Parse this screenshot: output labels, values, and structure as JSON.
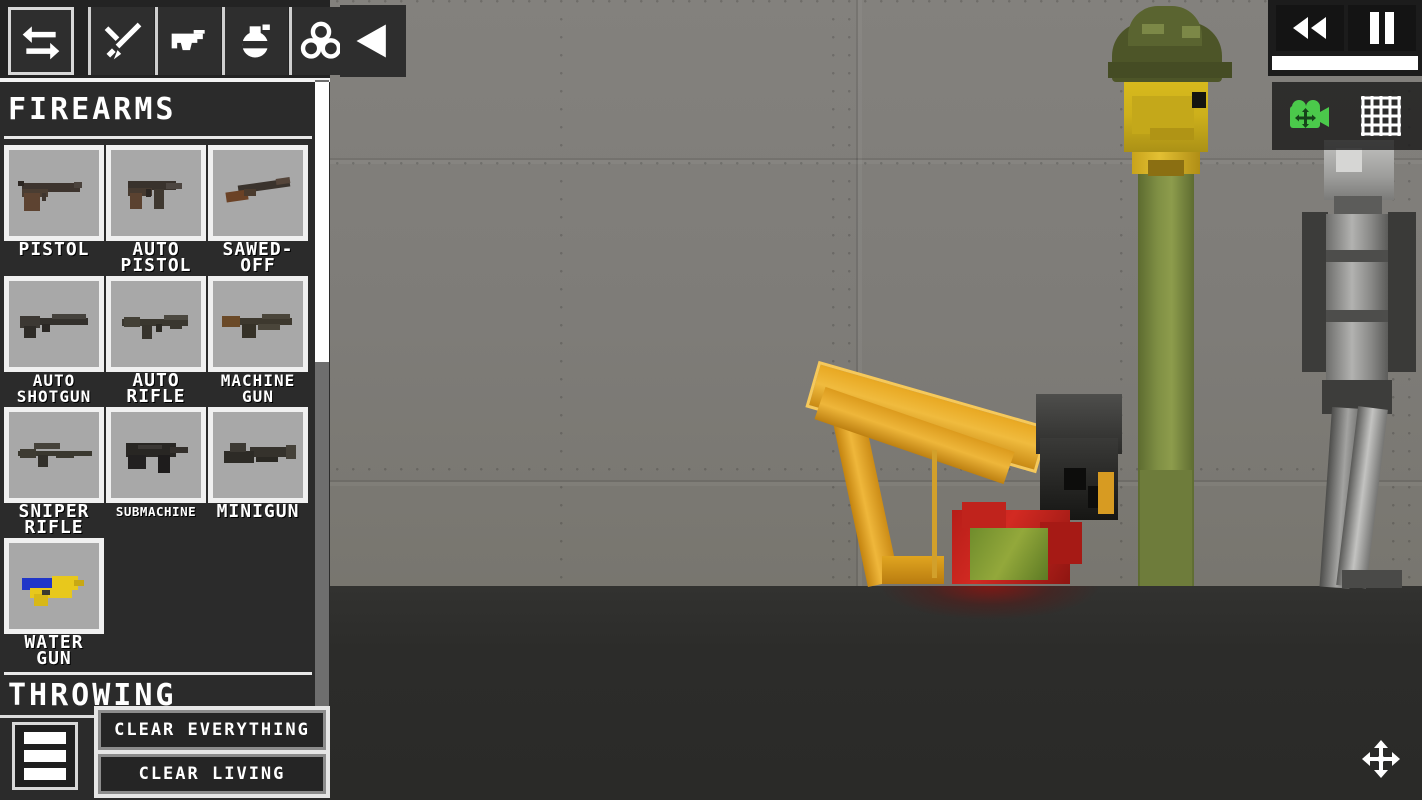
{
  "toolbar": {
    "items": [
      {
        "name": "swap-icon",
        "label": "Swap"
      },
      {
        "name": "melee-icon",
        "label": "Melee"
      },
      {
        "name": "firearms-icon",
        "label": "Firearms"
      },
      {
        "name": "throwing-icon",
        "label": "Throwing"
      },
      {
        "name": "biohazard-icon",
        "label": "Biohazard"
      }
    ]
  },
  "back_button": {
    "label": "Back",
    "icon": "left-triangle-icon"
  },
  "sidebar": {
    "sections": [
      {
        "title": "FIREARMS"
      },
      {
        "title": "THROWING"
      }
    ],
    "weapons": [
      {
        "label": "PISTOL",
        "icon": "pistol-icon",
        "size": "s18"
      },
      {
        "label": "AUTO\nPISTOL",
        "icon": "auto-pistol-icon",
        "size": "s18"
      },
      {
        "label": "SAWED-\nOFF",
        "icon": "sawed-off-icon",
        "size": "s18"
      },
      {
        "label": "AUTO\nSHOTGUN",
        "icon": "auto-shotgun-icon",
        "size": "s16"
      },
      {
        "label": "AUTO\nRIFLE",
        "icon": "auto-rifle-icon",
        "size": "s18"
      },
      {
        "label": "MACHINE\nGUN",
        "icon": "machine-gun-icon",
        "size": "s16"
      },
      {
        "label": "SNIPER\nRIFLE",
        "icon": "sniper-rifle-icon",
        "size": "s18"
      },
      {
        "label": "SUBMACHINE",
        "icon": "submachine-icon",
        "size": "s13"
      },
      {
        "label": "MINIGUN",
        "icon": "minigun-icon",
        "size": "s18"
      },
      {
        "label": "WATER\nGUN",
        "icon": "water-gun-icon",
        "size": "s18"
      }
    ],
    "menu_button": {
      "name": "menu-icon",
      "label": "Menu"
    },
    "clear_everything": "CLEAR EVERYTHING",
    "clear_living": "CLEAR LIVING"
  },
  "top_right": {
    "rewind_label": "Rewind",
    "pause_label": "Pause",
    "progress_percent": 100,
    "camera_label": "Camera Move",
    "grid_label": "Grid"
  },
  "bottom_right": {
    "move_cursor_label": "Move"
  },
  "colors": {
    "panel_bg": "#2b2b2b",
    "panel_dark": "#1c1c1c",
    "tile_fill": "#a8a8a8",
    "tile_border": "#f0f0f0",
    "text": "#ffffff",
    "accent_green": "#4bc94b",
    "scrollbar_thumb": "#ffffff",
    "scrollbar_track": "#6e6e6e",
    "wall": "#807e7a",
    "floor": "#2c2c2a",
    "blood": "#96100c"
  }
}
